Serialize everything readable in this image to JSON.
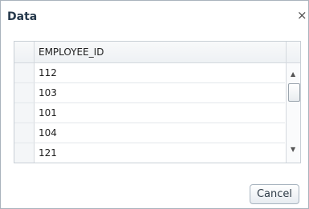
{
  "dialog": {
    "title": "Data",
    "close_glyph": "×"
  },
  "grid": {
    "columns": [
      "EMPLOYEE_ID"
    ],
    "rows": [
      "112",
      "103",
      "101",
      "104",
      "121"
    ]
  },
  "scrollbar": {
    "up_glyph": "▲",
    "down_glyph": "▼"
  },
  "buttons": {
    "cancel_label": "Cancel"
  },
  "colors": {
    "title": "#26394c",
    "border": "#a9b3bd"
  }
}
